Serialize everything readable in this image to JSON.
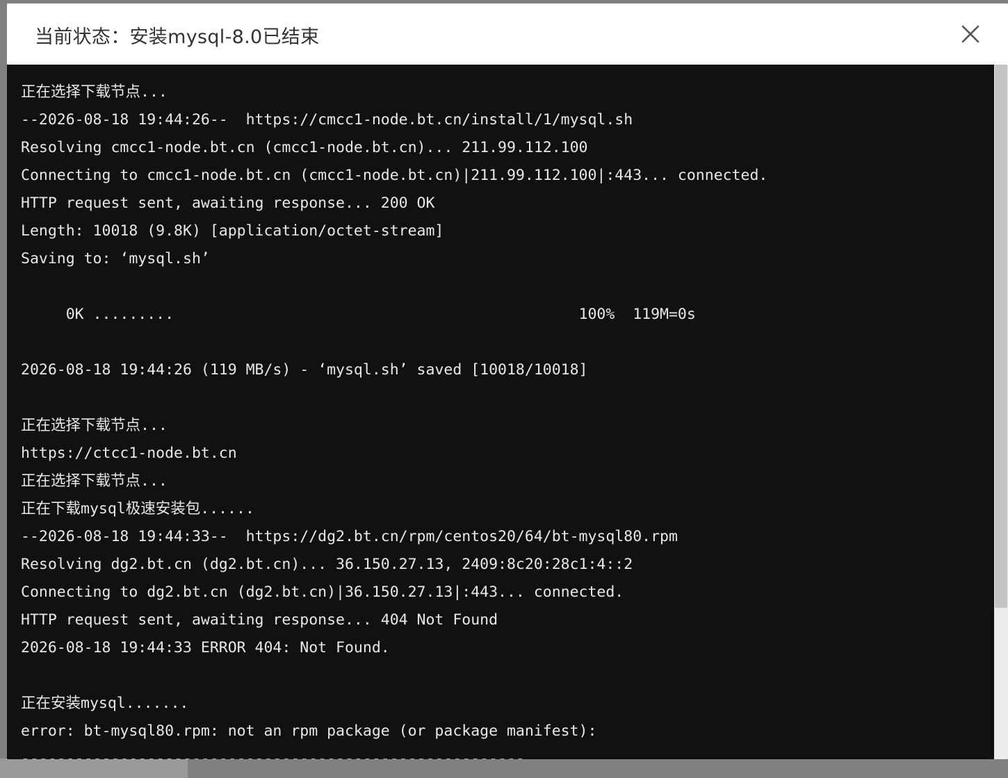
{
  "dialog": {
    "title": "当前状态：安装mysql-8.0已结束",
    "close_icon": "close-icon"
  },
  "terminal": {
    "lines": [
      "正在选择下载节点...",
      "--2026-08-18 19:44:26--  https://cmcc1-node.bt.cn/install/1/mysql.sh",
      "Resolving cmcc1-node.bt.cn (cmcc1-node.bt.cn)... 211.99.112.100",
      "Connecting to cmcc1-node.bt.cn (cmcc1-node.bt.cn)|211.99.112.100|:443... connected.",
      "HTTP request sent, awaiting response... 200 OK",
      "Length: 10018 (9.8K) [application/octet-stream]",
      "Saving to: ‘mysql.sh’",
      "",
      "     0K .........                                             100%  119M=0s",
      "",
      "2026-08-18 19:44:26 (119 MB/s) - ‘mysql.sh’ saved [10018/10018]",
      "",
      "正在选择下载节点...",
      "https://ctcc1-node.bt.cn",
      "正在选择下载节点...",
      "正在下载mysql极速安装包......",
      "--2026-08-18 19:44:33--  https://dg2.bt.cn/rpm/centos20/64/bt-mysql80.rpm",
      "Resolving dg2.bt.cn (dg2.bt.cn)... 36.150.27.13, 2409:8c20:28c1:4::2",
      "Connecting to dg2.bt.cn (dg2.bt.cn)|36.150.27.13|:443... connected.",
      "HTTP request sent, awaiting response... 404 Not Found",
      "2026-08-18 19:44:33 ERROR 404: Not Found.",
      "",
      "正在安装mysql.......",
      "error: bt-mysql80.rpm: not an rpm package (or package manifest):",
      "--------------------------------------------------------"
    ]
  },
  "colors": {
    "terminal_bg": "#111111",
    "terminal_text": "#e8e8e8",
    "header_bg": "#ffffff",
    "overlay": "#808080"
  }
}
